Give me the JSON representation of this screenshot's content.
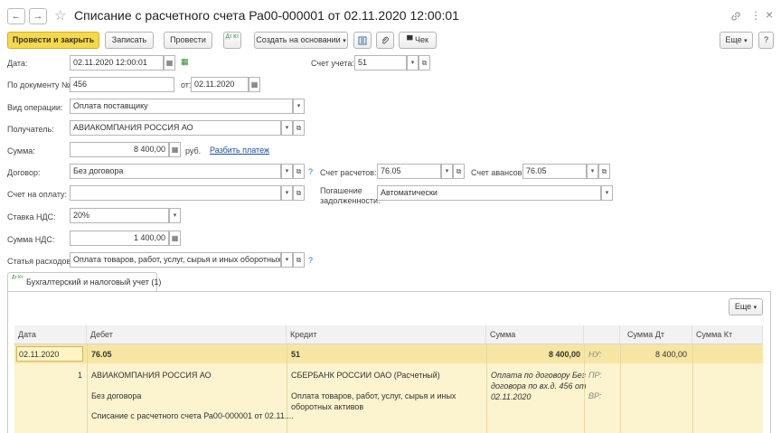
{
  "window": {
    "title": "Списание с расчетного счета Ра00-000001 от 02.11.2020 12:00:01",
    "back": "←",
    "forward": "→",
    "star": "☆",
    "link_glyph": "🔗",
    "menu_glyph": "⋮",
    "close_glyph": "×"
  },
  "toolbar": {
    "post_close": "Провести и закрыть",
    "save": "Записать",
    "post": "Провести",
    "dtkt": "Дт Кт",
    "create_based": "Создать на основании",
    "more": "Еще",
    "help": "?",
    "check": "Чек"
  },
  "form": {
    "date_label": "Дата:",
    "date_value": "02.11.2020 12:00:01",
    "account_label": "Счет учета:",
    "account_value": "51",
    "docnum_label": "По документу №:",
    "docnum_value": "456",
    "from_label": "от:",
    "from_value": "02.11.2020",
    "operation_label": "Вид операции:",
    "operation_value": "Оплата поставщику",
    "recipient_label": "Получатель:",
    "recipient_value": "АВИАКОМПАНИЯ РОССИЯ АО",
    "sum_label": "Сумма:",
    "sum_value": "8 400,00",
    "currency": "руб.",
    "split_link": "Разбить платеж",
    "contract_label": "Договор:",
    "contract_value": "Без договора",
    "settle_acc_label": "Счет расчетов:",
    "settle_acc_value": "76.05",
    "advance_acc_label": "Счет авансов:",
    "advance_acc_value": "76.05",
    "invoice_label": "Счет на оплату:",
    "invoice_value": "",
    "repay_label_1": "Погашение",
    "repay_label_2": "задолженности:",
    "repay_value": "Автоматически",
    "vat_rate_label": "Ставка НДС:",
    "vat_rate_value": "20%",
    "vat_sum_label": "Сумма НДС:",
    "vat_sum_value": "1 400,00",
    "expense_label": "Статья расходов:",
    "expense_value": "Оплата товаров, работ, услуг, сырья и иных оборотных акти",
    "question": "?"
  },
  "tab": {
    "label": "Бухгалтерский и налоговый учет (1)"
  },
  "table": {
    "more": "Еще",
    "columns": [
      "Дата",
      "Дебет",
      "Кредит",
      "Сумма",
      "",
      "Сумма Дт",
      "Сумма Кт"
    ],
    "row": {
      "date": "02.11.2020",
      "num": "1",
      "debit_acc": "76.05",
      "debit_sub1": "АВИАКОМПАНИЯ РОССИЯ АО",
      "debit_sub2": "Без договора",
      "debit_sub3": "Списание с расчетного счета Ра00-000001 от 02.11....",
      "credit_acc": "51",
      "credit_sub1": "СБЕРБАНК РОССИИ ОАО (Расчетный)",
      "credit_sub2a": "Оплата товаров, работ, услуг, сырья и иных",
      "credit_sub2b": "оборотных активов",
      "sum": "8 400,00",
      "content_1": "Оплата по договору Без",
      "content_2": "договора по вх.д. 456 от",
      "content_3": "02.11.2020",
      "nu": "НУ:",
      "pr": "ПР:",
      "vr": "ВР:",
      "sum_dt": "8 400,00"
    }
  },
  "colors": {
    "primary_button": "#f6d94a",
    "selected_row": "#fcf3cf",
    "link": "#1a4fa0"
  }
}
